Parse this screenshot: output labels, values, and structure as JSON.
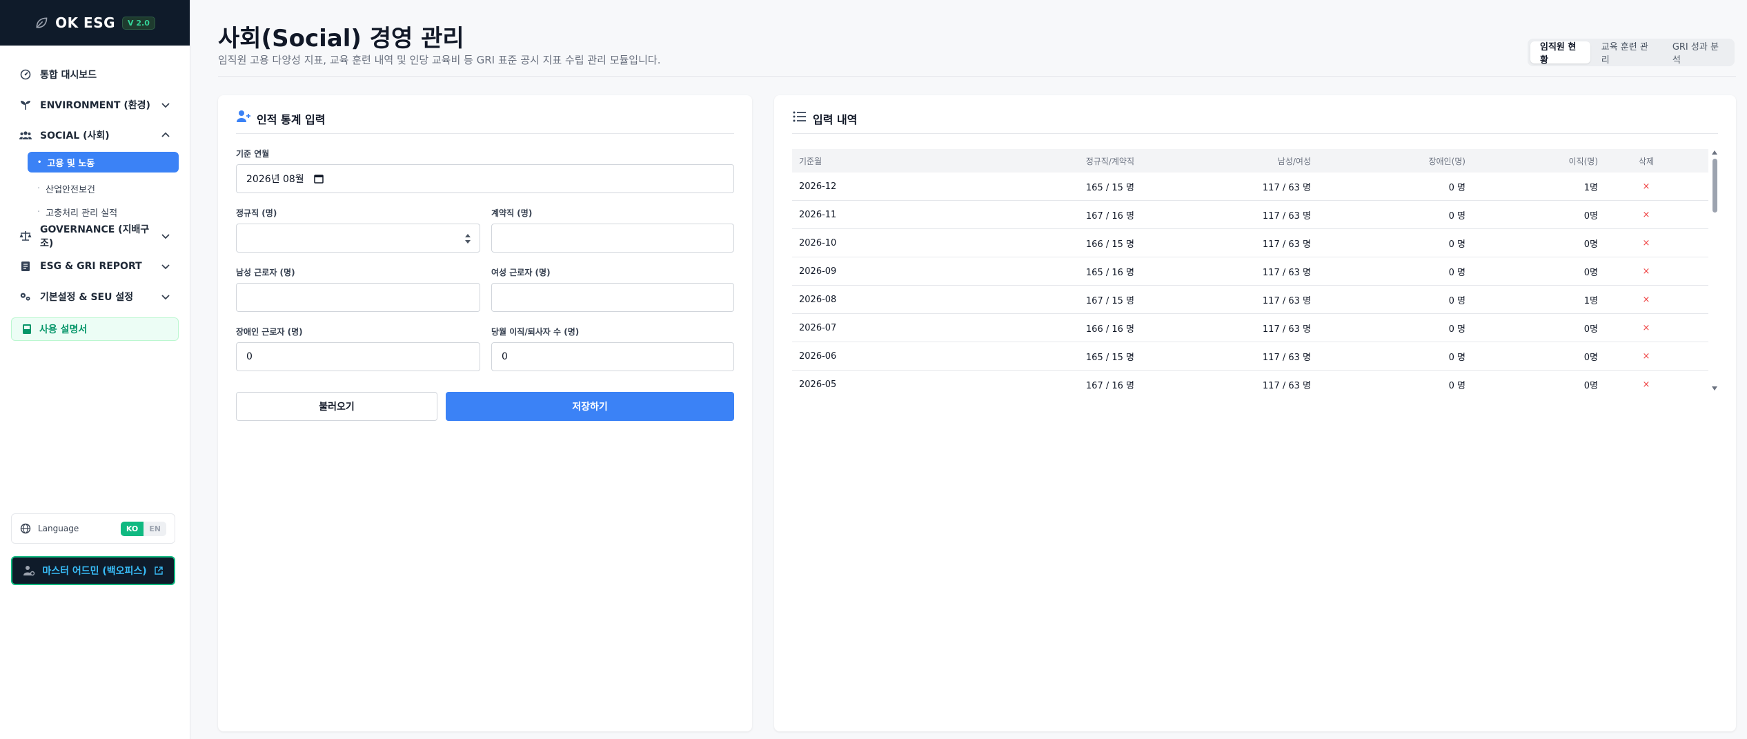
{
  "brand": {
    "name": "OK ESG",
    "version": "V 2.0"
  },
  "sidebar": {
    "items": [
      {
        "label": "통합 대시보드",
        "icon": "dashboard-icon"
      },
      {
        "label": "ENVIRONMENT (환경)",
        "icon": "leaf-icon"
      },
      {
        "label": "SOCIAL (사회)",
        "icon": "users-icon"
      },
      {
        "label": "GOVERNANCE (지배구조)",
        "icon": "scale-icon"
      },
      {
        "label": "ESG & GRI REPORT",
        "icon": "report-icon"
      },
      {
        "label": "기본설정 & SEU 설정",
        "icon": "gears-icon"
      }
    ],
    "social_sub": [
      {
        "label": "고용 및 노동",
        "active": true
      },
      {
        "label": "산업안전보건",
        "active": false
      },
      {
        "label": "고충처리 관리 실적",
        "active": false
      }
    ],
    "guide": "사용 설명서",
    "language": {
      "label": "Language",
      "ko": "KO",
      "en": "EN"
    },
    "admin": "마스터 어드민 (백오피스)"
  },
  "header": {
    "title": "사회(Social) 경영 관리",
    "subtitle": "임직원 고용 다양성 지표, 교육 훈련 내역 및 인당 교육비 등 GRI 표준 공시 지표 수립 관리 모듈입니다.",
    "tabs": [
      "임직원 현황",
      "교육 훈련 관리",
      "GRI 성과 분석"
    ]
  },
  "form": {
    "title": "인적 통계 입력",
    "month_label": "기준 연월",
    "month_value": "2026년 08월",
    "regular_label": "정규직 (명)",
    "contract_label": "계약직 (명)",
    "male_label": "남성 근로자 (명)",
    "female_label": "여성 근로자 (명)",
    "disabled_label": "장애인 근로자 (명)",
    "disabled_value": "0",
    "turnover_label": "당월 이직/퇴사자 수 (명)",
    "turnover_value": "0",
    "load_button": "불러오기",
    "save_button": "저장하기"
  },
  "history": {
    "title": "입력 내역",
    "columns": [
      "기준월",
      "정규직/계약직",
      "남성/여성",
      "장애인(명)",
      "이직(명)",
      "삭제"
    ],
    "delete_symbol": "×",
    "rows": [
      [
        "2026-12",
        "165 / 15 명",
        "117 / 63 명",
        "0 명",
        "1명"
      ],
      [
        "2026-11",
        "167 / 16 명",
        "117 / 63 명",
        "0 명",
        "0명"
      ],
      [
        "2026-10",
        "166 / 15 명",
        "117 / 63 명",
        "0 명",
        "0명"
      ],
      [
        "2026-09",
        "165 / 16 명",
        "117 / 63 명",
        "0 명",
        "0명"
      ],
      [
        "2026-08",
        "167 / 15 명",
        "117 / 63 명",
        "0 명",
        "1명"
      ],
      [
        "2026-07",
        "166 / 16 명",
        "117 / 63 명",
        "0 명",
        "0명"
      ],
      [
        "2026-06",
        "165 / 15 명",
        "117 / 63 명",
        "0 명",
        "0명"
      ],
      [
        "2026-05",
        "167 / 16 명",
        "117 / 63 명",
        "0 명",
        "0명"
      ]
    ]
  },
  "colors": {
    "accent": "#3b82f6",
    "brand_bg": "#0f1b2a",
    "green": "#10b981",
    "danger": "#ef4444"
  }
}
